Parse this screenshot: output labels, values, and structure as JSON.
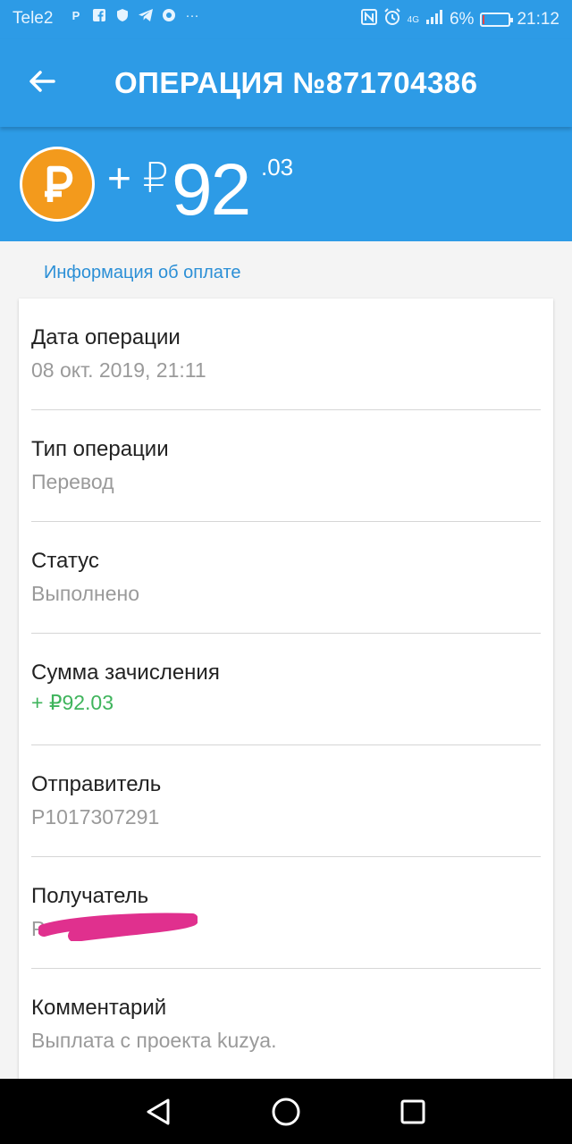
{
  "status_bar": {
    "carrier": "Tele2",
    "network": "4G",
    "battery": "6%",
    "battery_level": 0.06,
    "time": "21:12",
    "icons": [
      "p-icon",
      "facebook-icon",
      "shield-icon",
      "telegram-icon",
      "chrome-icon",
      "more-icon",
      "nfc-icon",
      "alarm-icon",
      "signal-icon",
      "battery-icon"
    ]
  },
  "header": {
    "title": "ОПЕРАЦИЯ №871704386",
    "back_icon": "arrow-left-icon"
  },
  "amount": {
    "sign": "+ ₽",
    "integer": "92",
    "decimal": ".03",
    "icon": "ruble-coin-icon",
    "icon_color": "#f39a1c"
  },
  "section_title": "Информация об оплате",
  "details": [
    {
      "label": "Дата операции",
      "value": "08 окт. 2019, 21:11"
    },
    {
      "label": "Тип операции",
      "value": "Перевод"
    },
    {
      "label": "Статус",
      "value": "Выполнено"
    },
    {
      "label": "Сумма зачисления",
      "value": "+ ₽92.03",
      "value_color": "#3fb45c"
    },
    {
      "label": "Отправитель",
      "value": "P1017307291"
    },
    {
      "label": "Получатель",
      "value": "P"
    },
    {
      "label": "Комментарий",
      "value": "Выплата с проекта kuzya."
    }
  ],
  "colors": {
    "primary": "#2d9be6",
    "accent_text": "#2b8fd6",
    "positive": "#3fb45c",
    "redaction": "#e0308e"
  },
  "nav_bar": {
    "icons": [
      "back-triangle-icon",
      "home-circle-icon",
      "recents-square-icon"
    ]
  }
}
